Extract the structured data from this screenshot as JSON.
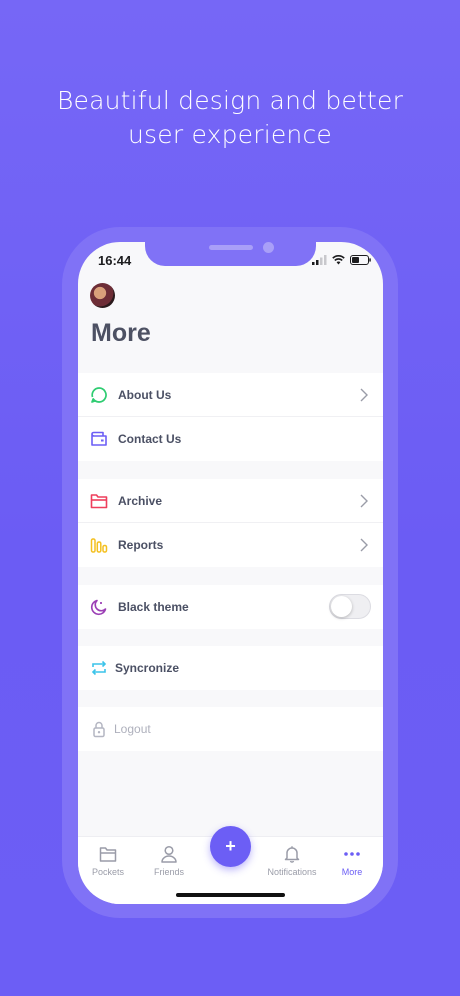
{
  "headline": {
    "line1": "Beautiful design and better",
    "line2": "user experience"
  },
  "status_bar": {
    "time": "16:44"
  },
  "page": {
    "title": "More"
  },
  "menu": {
    "about": "About Us",
    "contact": "Contact Us",
    "archive": "Archive",
    "reports": "Reports",
    "black_theme": "Black theme",
    "black_theme_enabled": false,
    "sync": "Syncronize",
    "logout": "Logout"
  },
  "tabbar": {
    "pockets": "Pockets",
    "friends": "Friends",
    "add": "+",
    "notifications": "Notifications",
    "more": "More"
  },
  "colors": {
    "background": "#6c5ef5",
    "accent": "#6c5ef5",
    "about_icon": "#2ecc71",
    "contact_icon": "#6c5ef5",
    "archive_icon": "#ee3e5c",
    "reports_icon": "#f4c020",
    "theme_icon": "#9b3fb5",
    "sync_icon": "#3cc4ea"
  }
}
